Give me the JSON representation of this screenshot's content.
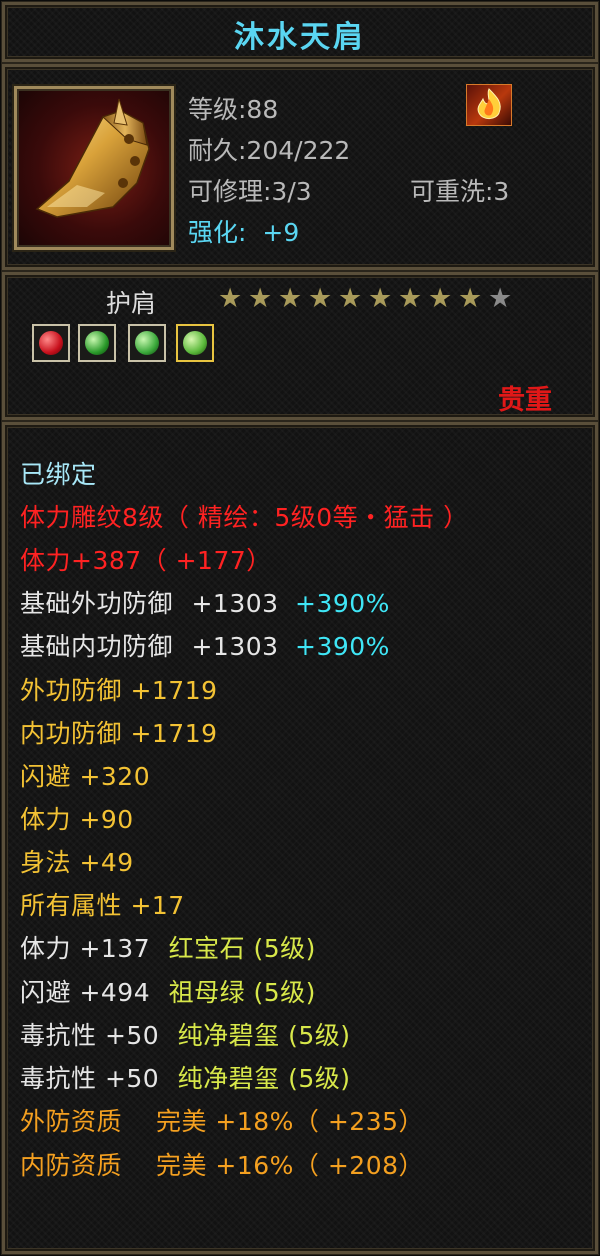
{
  "item": {
    "name": "沐水天肩",
    "type": "护肩",
    "level_label": "等级:88",
    "durability_label": "耐久:204/222",
    "repair_label": "可修理:3/3",
    "rewash_label": "可重洗:3",
    "enhance_label": "强化:",
    "enhance_value": "+9",
    "rarity_label": "贵重",
    "stars": {
      "filled": 9,
      "total": 10
    },
    "gems": [
      {
        "icon": "red-ruby-gem-icon",
        "color": "#d0202a"
      },
      {
        "icon": "green-emerald-gem-icon",
        "color": "#3aa83a"
      },
      {
        "icon": "green-jade-gem-icon",
        "color": "#3aa83a"
      },
      {
        "icon": "green-jade-gem-icon",
        "color": "#5ab83a"
      }
    ]
  },
  "attributes": {
    "bound": "已绑定",
    "engrave": "体力雕纹8级（ 精绘：5级0等・猛击 ）",
    "stamina_bonus": "体力+387（ +177）",
    "rows": [
      {
        "name": "基础外功防御",
        "value": "+1303",
        "extra": "+390%"
      },
      {
        "name": "基础内功防御",
        "value": "+1303",
        "extra": "+390%"
      }
    ],
    "yellow_rows": [
      "外功防御 +1719",
      "内功防御 +1719",
      "闪避 +320",
      "体力 +90",
      "身法 +49",
      "所有属性 +17"
    ],
    "gem_rows": [
      {
        "name": "体力 +137",
        "gem": "红宝石 (5级)"
      },
      {
        "name": "闪避 +494",
        "gem": "祖母绿 (5级)"
      },
      {
        "name": "毒抗性 +50",
        "gem": "纯净碧玺 (5级)"
      },
      {
        "name": "毒抗性 +50",
        "gem": "纯净碧玺 (5级)"
      }
    ],
    "quality_rows": [
      "外防资质　 完美 +18%（ +235）",
      "内防资质　 完美 +16%（ +208）"
    ]
  },
  "colors": {
    "title": "#5ad6f2",
    "valuable": "#e01818",
    "engrave": "#ff2222",
    "yellow": "#f3c234",
    "orange": "#f4a020",
    "star_filled": "#a89a5a",
    "star_empty": "#8a8a8a"
  }
}
